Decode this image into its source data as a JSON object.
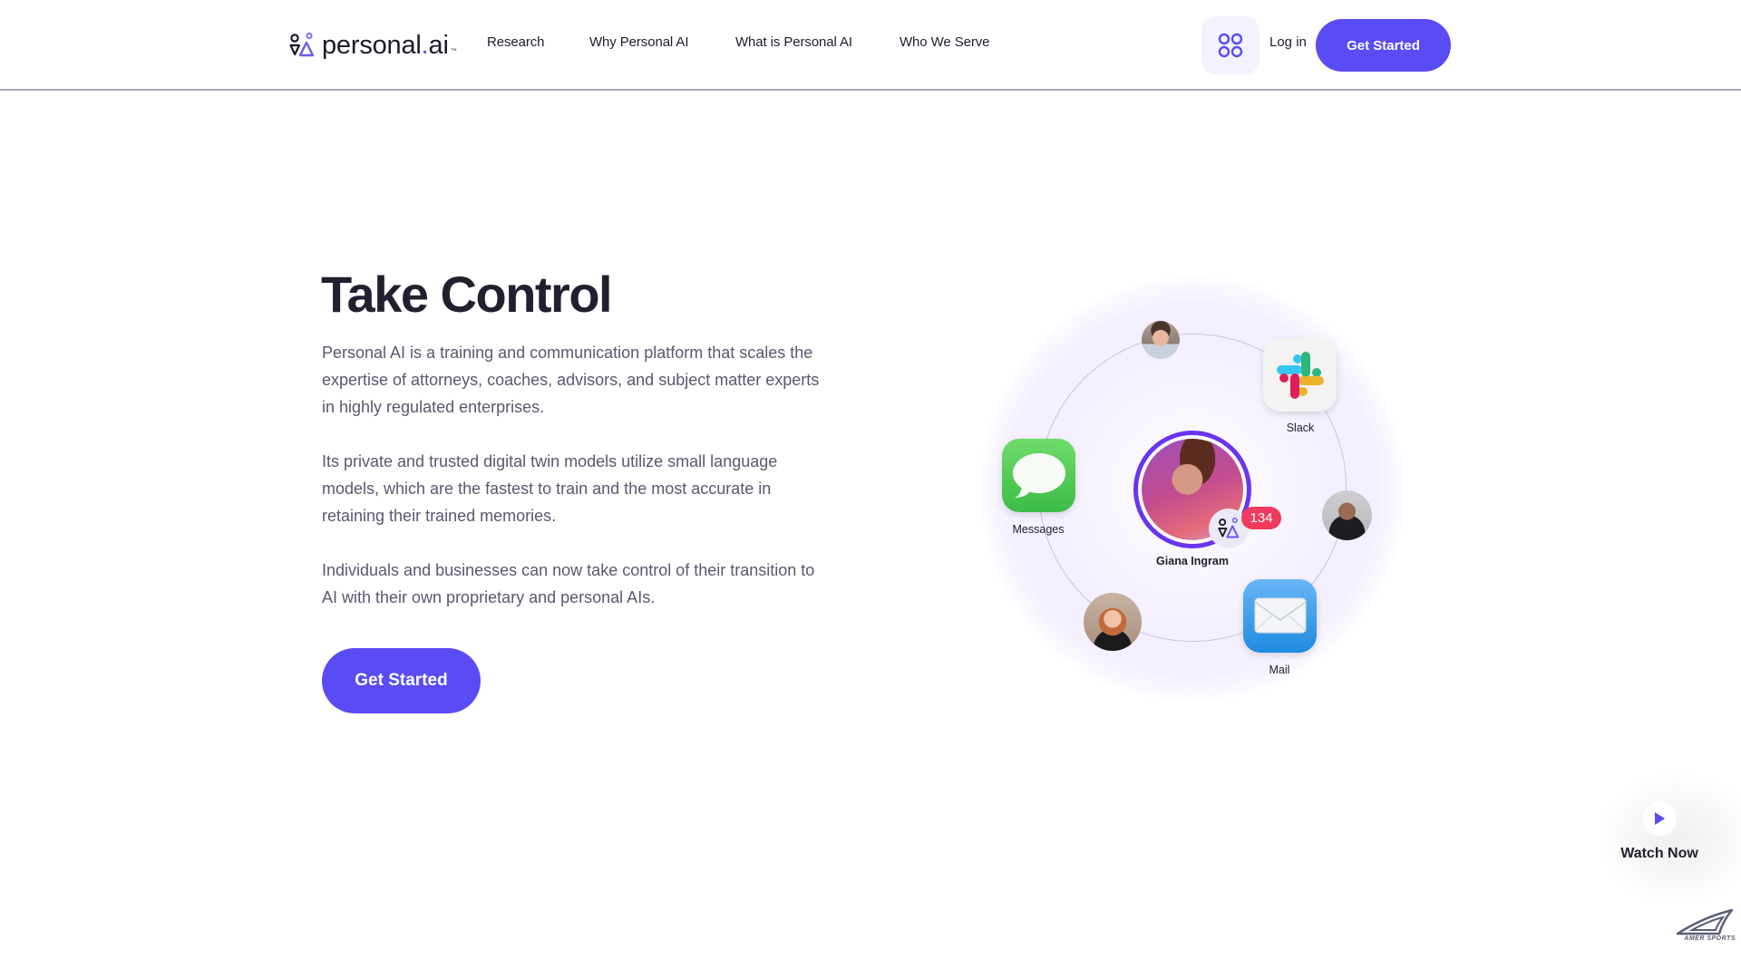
{
  "header": {
    "logo": {
      "text_main": "personal",
      "text_dot": ".",
      "text_tld": "ai",
      "trademark": "™"
    },
    "nav": [
      {
        "label": "Research"
      },
      {
        "label": "Why Personal AI"
      },
      {
        "label": "What is Personal AI"
      },
      {
        "label": "Who We Serve"
      }
    ],
    "apps_icon": "grid-icon",
    "login_label": "Log in",
    "cta_label": "Get Started"
  },
  "hero": {
    "title": "Take Control",
    "paragraphs": [
      "Personal AI is a training and communication platform that scales the expertise of attorneys, coaches, advisors, and subject matter experts in highly regulated enterprises.",
      "Its private and trusted digital twin models utilize small language models, which are the fastest to train and the most accurate in retaining their trained memories.",
      "Individuals and businesses can now take control of their transition to AI with their own proprietary and personal AIs."
    ],
    "cta_label": "Get Started"
  },
  "network": {
    "center": {
      "name": "Giana Ingram",
      "notification_count": "134"
    },
    "apps": [
      {
        "name": "Slack",
        "icon": "slack-icon"
      },
      {
        "name": "Messages",
        "icon": "messages-icon"
      },
      {
        "name": "Mail",
        "icon": "mail-icon"
      }
    ],
    "contacts": [
      "contact-avatar-top",
      "contact-avatar-right",
      "contact-avatar-bottom-left"
    ]
  },
  "watch": {
    "label": "Watch Now",
    "icon": "play-icon"
  },
  "partner_logo": {
    "text": "AMER SPORTS"
  },
  "colors": {
    "brand": "#5b4bf5",
    "badge_red": "#ef3b5d",
    "ring_purple": "#6a34f0",
    "text_dark": "#22202f",
    "text_body": "#5a5870"
  }
}
